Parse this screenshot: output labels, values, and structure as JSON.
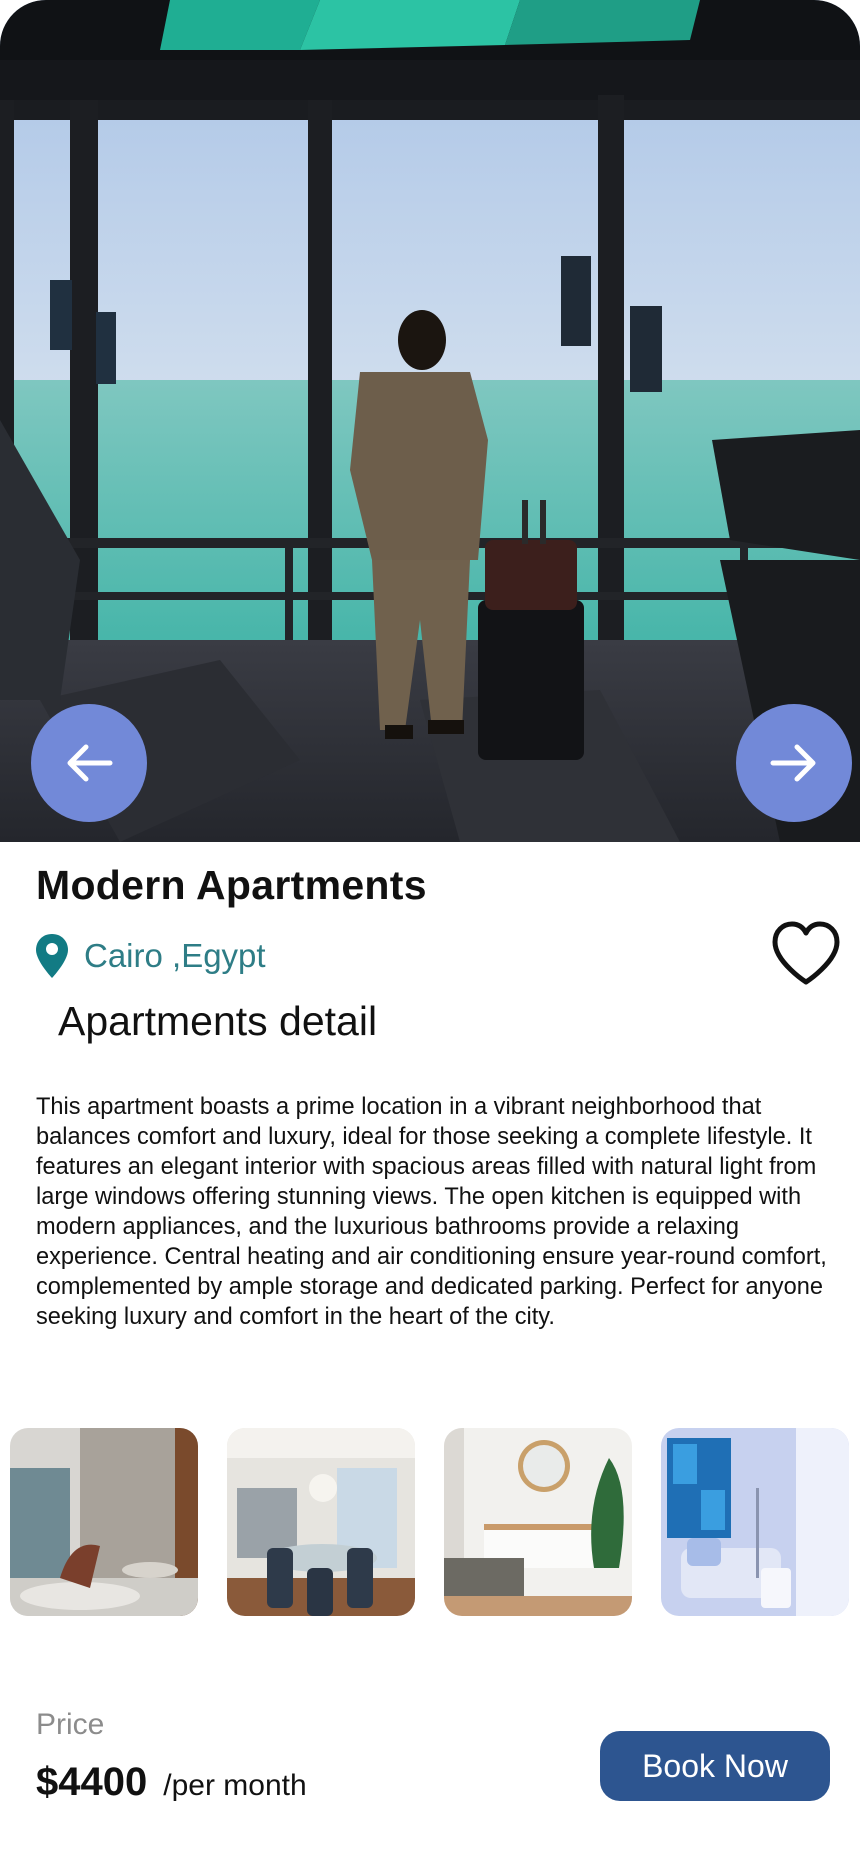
{
  "hero": {
    "image_description": "hero-photo",
    "prev_icon": "arrow-left-icon",
    "next_icon": "arrow-right-icon"
  },
  "listing": {
    "title": "Modern Apartments",
    "location": "Cairo ,Egypt",
    "location_icon": "map-pin-icon",
    "favorite_icon": "heart-outline-icon",
    "accent_color": "#2e7d86"
  },
  "details": {
    "heading": "Apartments detail",
    "description": "This apartment boasts a prime location in a vibrant neighborhood that balances comfort and luxury, ideal for those seeking a complete lifestyle. It features an elegant interior with spacious areas filled with natural light from large windows offering stunning views. The open kitchen is equipped with modern appliances, and the luxurious bathrooms provide a relaxing experience. Central heating and air conditioning ensure year-round comfort, complemented by ample storage and dedicated parking. Perfect for anyone seeking luxury and comfort in the heart of the city."
  },
  "gallery": {
    "thumbnails": [
      "living-area-thumbnail",
      "dining-room-thumbnail",
      "bedroom-thumbnail",
      "lounge-thumbnail"
    ]
  },
  "pricing": {
    "label": "Price",
    "amount": "$4400",
    "period": "/per month",
    "button_label": "Book Now",
    "button_color": "#2d5590"
  }
}
